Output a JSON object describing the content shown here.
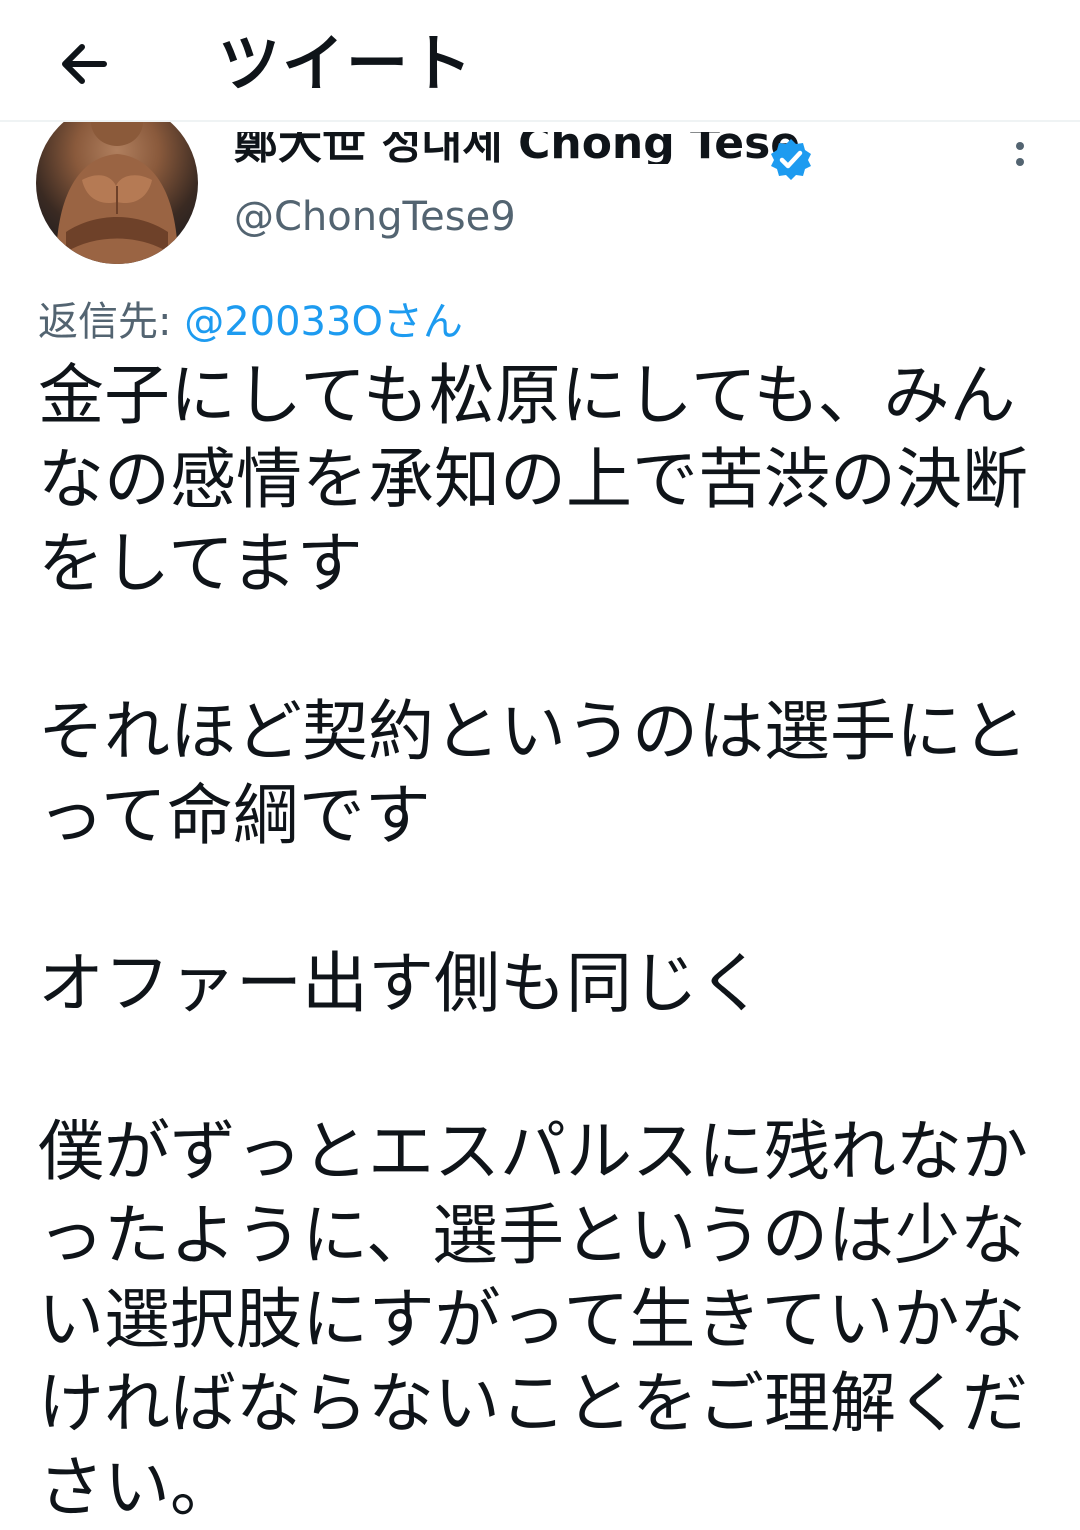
{
  "header": {
    "title": "ツイート",
    "back_icon": "arrow-left-icon"
  },
  "tweet": {
    "display_name": "鄭大世 정대세 Chong Tese",
    "verified_icon": "verified-badge-icon",
    "handle": "@ChongTese9",
    "more_icon": "more-vertical-icon",
    "reply_label": "返信先:",
    "reply_mention": "@20033Oさん",
    "body": "金子にしても松原にしても、みんなの感情を承知の上で苦渋の決断をしてます\n\nそれほど契約というのは選手にとって命綱です\n\nオファー出す側も同じく\n\n僕がずっとエスパルスに残れなかったように、選手というのは少ない選択肢にすがって生きていかなければならないことをご理解ください。"
  },
  "colors": {
    "text": "#0f1419",
    "secondary": "#536471",
    "link": "#1d9bf0",
    "verified": "#1d9bf0"
  }
}
